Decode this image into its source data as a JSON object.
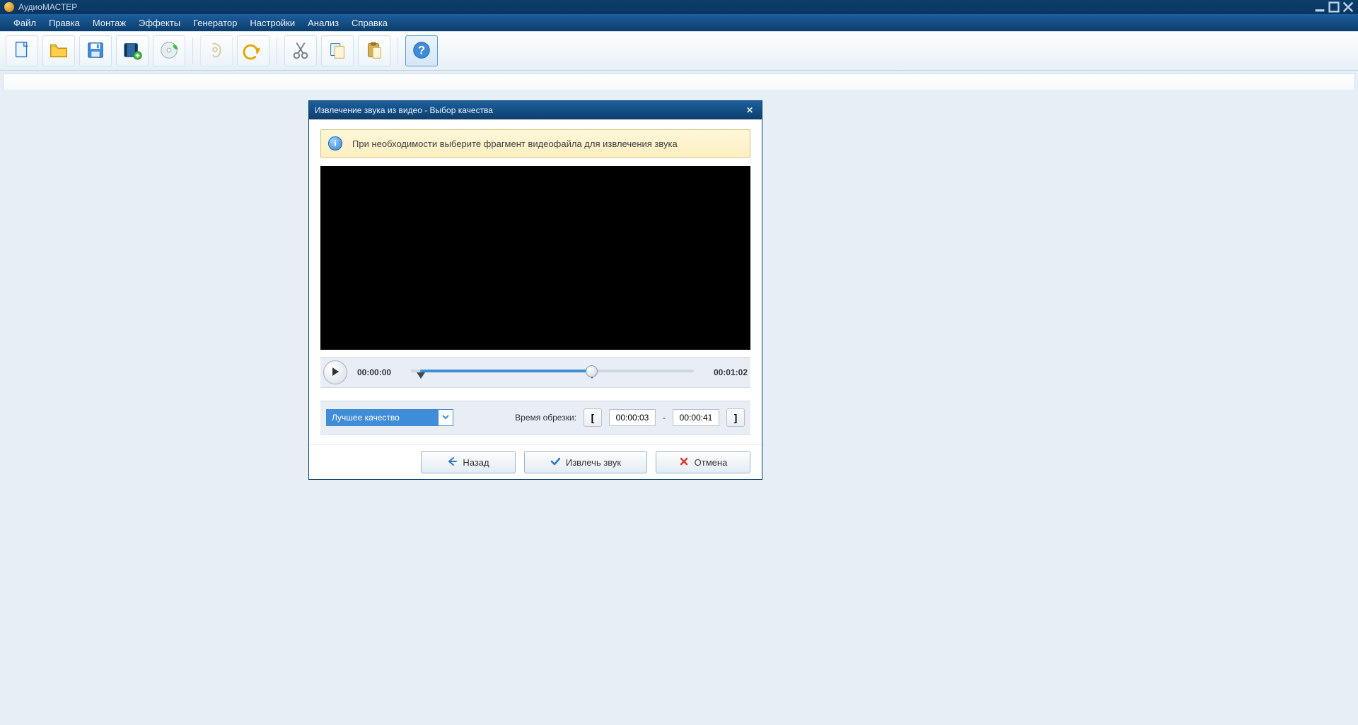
{
  "app": {
    "title": "АудиоМАСТЕР"
  },
  "menu": {
    "items": [
      "Файл",
      "Правка",
      "Монтаж",
      "Эффекты",
      "Генератор",
      "Настройки",
      "Анализ",
      "Справка"
    ]
  },
  "toolbar": {
    "buttons": [
      {
        "name": "new-file-icon"
      },
      {
        "name": "open-folder-icon"
      },
      {
        "name": "save-disk-icon"
      },
      {
        "name": "add-video-icon"
      },
      {
        "name": "cd-audio-icon"
      },
      {
        "sep": true
      },
      {
        "name": "record-icon",
        "disabled": true
      },
      {
        "name": "undo-icon"
      },
      {
        "sep": true
      },
      {
        "name": "cut-scissors-icon"
      },
      {
        "name": "copy-icon"
      },
      {
        "name": "paste-icon"
      },
      {
        "sep": true
      },
      {
        "name": "help-icon",
        "active": true
      }
    ]
  },
  "dialog": {
    "title": "Извлечение звука из видео - Выбор качества",
    "info_message": "При необходимости выберите фрагмент видеофайла для извлечения звука",
    "player": {
      "current_time": "00:00:00",
      "total_time": "00:01:02"
    },
    "quality_combo": {
      "selected": "Лучшее качество"
    },
    "trim": {
      "label": "Время обрезки:",
      "start_time": "00:00:03",
      "end_time": "00:00:41",
      "dash": "-"
    },
    "buttons": {
      "back": "Назад",
      "extract": "Извлечь звук",
      "cancel": "Отмена"
    }
  }
}
